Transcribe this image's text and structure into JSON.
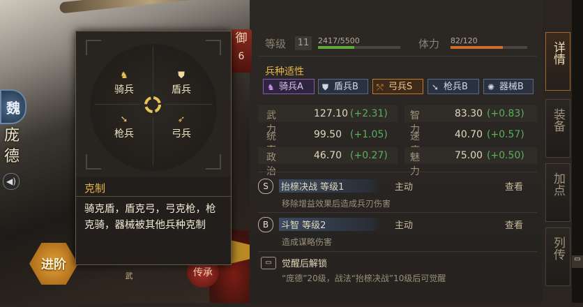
{
  "hero": {
    "faction": "魏",
    "name": "庞德",
    "advance_label": "进阶",
    "wu_label": "武",
    "inherit_label": "传承",
    "defense_label": "御",
    "defense_value": "6"
  },
  "popup": {
    "units": {
      "cavalry": "骑兵",
      "shield": "盾兵",
      "spear": "枪兵",
      "bow": "弓兵"
    },
    "title": "克制",
    "description": "骑克盾，盾克弓，弓克枪，枪克骑，器械被其他兵种克制"
  },
  "level": {
    "label": "等级",
    "value": "11",
    "exp_text": "2417/5500",
    "exp_fraction": 0.44
  },
  "stamina": {
    "label": "体力",
    "text": "82/120",
    "fraction": 0.683
  },
  "aptitude": {
    "title": "兵种适性",
    "items": [
      {
        "label": "骑兵A",
        "icon": "horse-icon"
      },
      {
        "label": "盾兵B",
        "icon": "shield-icon"
      },
      {
        "label": "弓兵S",
        "icon": "bow-icon"
      },
      {
        "label": "枪兵B",
        "icon": "spear-icon"
      },
      {
        "label": "器械B",
        "icon": "siege-icon"
      }
    ]
  },
  "stats": [
    {
      "name": "武力",
      "value": "127.10",
      "bonus": "(+2.31)"
    },
    {
      "name": "智力",
      "value": "83.30",
      "bonus": "(+0.83)"
    },
    {
      "name": "统率",
      "value": "99.50",
      "bonus": "(+1.05)"
    },
    {
      "name": "速度",
      "value": "40.70",
      "bonus": "(+0.57)"
    },
    {
      "name": "政治",
      "value": "46.70",
      "bonus": "(+0.27)"
    },
    {
      "name": "魅力",
      "value": "75.00",
      "bonus": "(+0.50)"
    }
  ],
  "skills": [
    {
      "grade": "S",
      "name": "抬榇决战 等级1",
      "type": "主动",
      "check": "查看",
      "desc": "移除增益效果后造成兵刃伤害"
    },
    {
      "grade": "B",
      "name": "斗智 等级2",
      "type": "主动",
      "check": "查看",
      "desc": "造成谋略伤害"
    }
  ],
  "awaken": {
    "title": "觉醒后解锁",
    "desc": "“庞德”20级，战法“抬榇决战”10级后可觉醒"
  },
  "tabs": {
    "detail": "详情",
    "equip": "装备",
    "bonus": "加点",
    "bio": "列传"
  }
}
